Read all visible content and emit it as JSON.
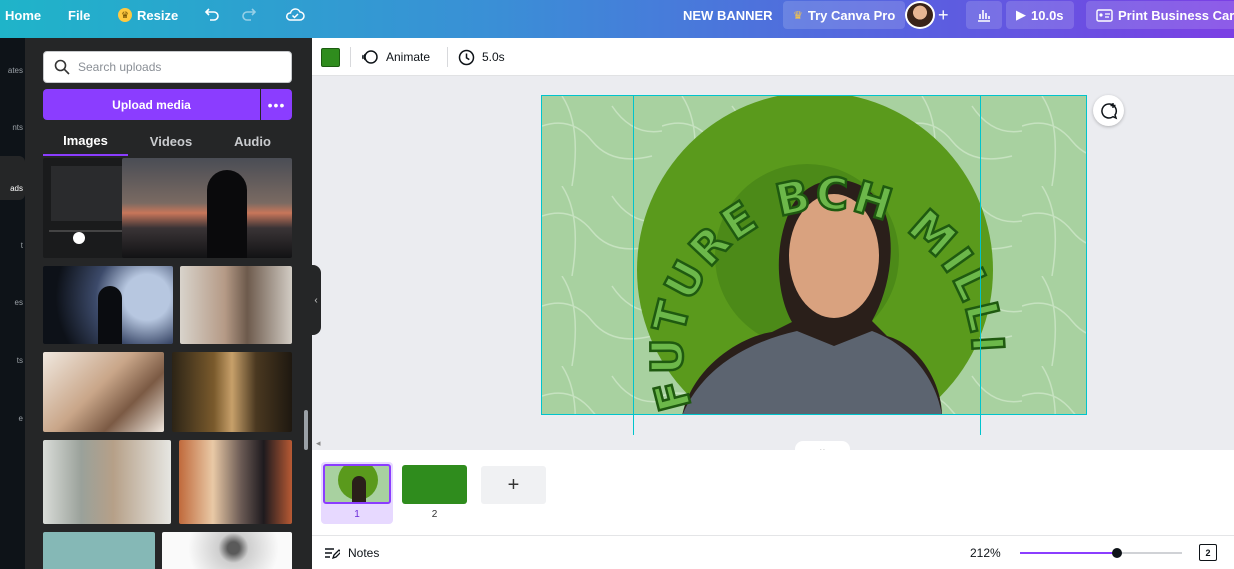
{
  "topbar": {
    "home": "Home",
    "file": "File",
    "resize": "Resize",
    "title": "NEW BANNER",
    "try_pro": "Try Canva Pro",
    "add": "+",
    "play_time": "10.0s",
    "print": "Print Business Cards"
  },
  "rail": {
    "items": [
      "ates",
      "nts",
      "ads",
      "t",
      "es",
      "ts",
      "e"
    ]
  },
  "panel": {
    "search_placeholder": "Search uploads",
    "upload_label": "Upload media",
    "more_label": "•••",
    "tabs": [
      "Images",
      "Videos",
      "Audio"
    ]
  },
  "toolbar": {
    "color": "#2f8c1d",
    "animate": "Animate",
    "duration": "5.0s"
  },
  "canvas": {
    "arc_text": "FUTURE BCH MILLIONAIRE",
    "bg_color": "#a8d1a0",
    "circle_color": "#5a9a1c"
  },
  "pages": [
    {
      "number": "1",
      "selected": true
    },
    {
      "number": "2",
      "selected": false
    }
  ],
  "add_page": "+",
  "bottom": {
    "notes": "Notes",
    "zoom": "212%",
    "zoom_level": 0.6,
    "page_count": "2"
  }
}
